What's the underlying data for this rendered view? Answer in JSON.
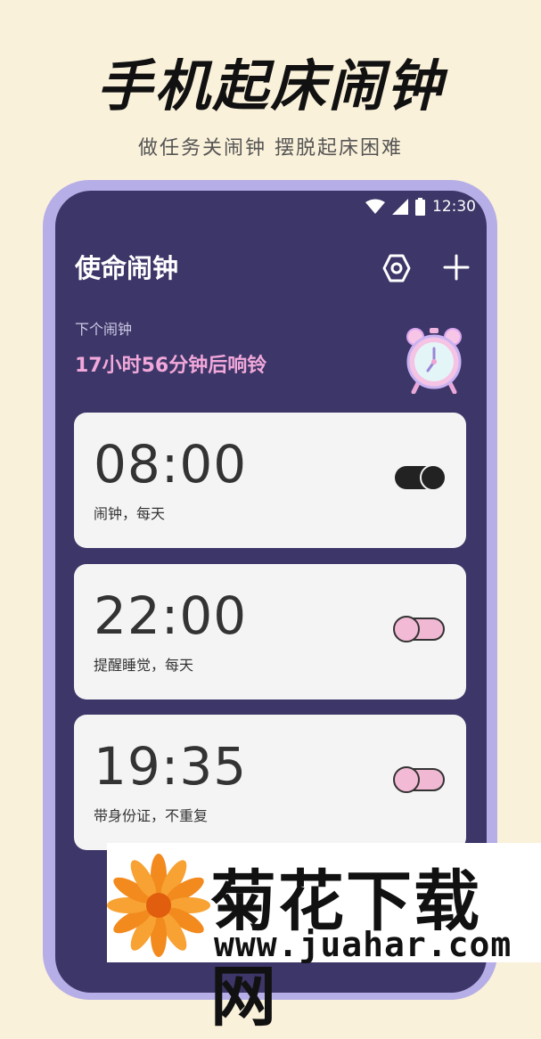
{
  "promo": {
    "headline": "手机起床闹钟",
    "subline": "做任务关闹钟 摆脱起床困难"
  },
  "status_bar": {
    "time": "12:30",
    "icons": [
      "wifi-icon",
      "signal-icon",
      "battery-icon"
    ]
  },
  "app": {
    "title": "使命闹钟",
    "settings_icon": "settings-hexagon-icon",
    "add_icon": "plus-icon"
  },
  "next_alarm": {
    "label": "下个闹钟",
    "value": "17小时56分钟后响铃",
    "illustration": "alarm-clock-icon"
  },
  "alarms": [
    {
      "time": "08:00",
      "description": "闹钟，每天",
      "enabled": true
    },
    {
      "time": "22:00",
      "description": "提醒睡觉，每天",
      "enabled": false
    },
    {
      "time": "19:35",
      "description": "带身份证，不重复",
      "enabled": false
    }
  ],
  "watermark": {
    "title": "菊花下载网",
    "url": "www.juahar.com"
  },
  "colors": {
    "background": "#FAF1DA",
    "frame": "#B6AEE6",
    "screen": "#3D3668",
    "accent_pink": "#F2A8DA",
    "card": "#F4F4F4"
  }
}
